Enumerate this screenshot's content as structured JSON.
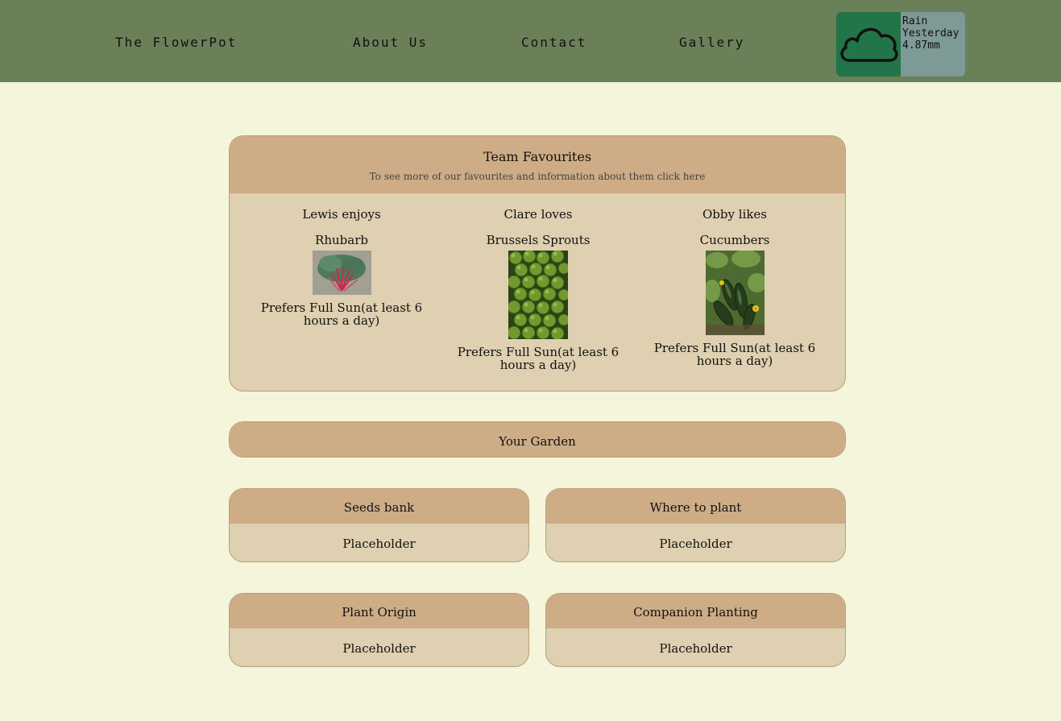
{
  "nav": {
    "brand": "The FlowerPot",
    "links": [
      "About Us",
      "Contact",
      "Gallery"
    ]
  },
  "weather": {
    "icon": "cloud-icon",
    "line1": "Rain",
    "line2": "Yesterday",
    "line3": "4.87mm",
    "colors": {
      "icon_bg": "#227549",
      "text_bg": "#7e9a96"
    }
  },
  "favourites": {
    "title": "Team Favourites",
    "subtitle": "To see more of our favourites and information about them click here",
    "members": [
      {
        "person": "Lewis enjoys",
        "plant": "Rhubarb",
        "sun": "Prefers Full Sun(at least 6 hours a day)"
      },
      {
        "person": "Clare loves",
        "plant": "Brussels Sprouts",
        "sun": "Prefers Full Sun(at least 6 hours a day)"
      },
      {
        "person": "Obby likes",
        "plant": "Cucumbers",
        "sun": "Prefers Full Sun(at least 6 hours a day)"
      }
    ]
  },
  "garden": {
    "title": "Your Garden",
    "cards": [
      {
        "title": "Seeds bank",
        "body": "Placeholder"
      },
      {
        "title": "Where to plant",
        "body": "Placeholder"
      },
      {
        "title": "Plant Origin",
        "body": "Placeholder"
      },
      {
        "title": "Companion Planting",
        "body": "Placeholder"
      }
    ]
  },
  "colors": {
    "nav_bg": "#6a8059",
    "page_bg": "#f5f5dc",
    "card_head": "#ceac86",
    "card_body": "#ded0b0"
  }
}
